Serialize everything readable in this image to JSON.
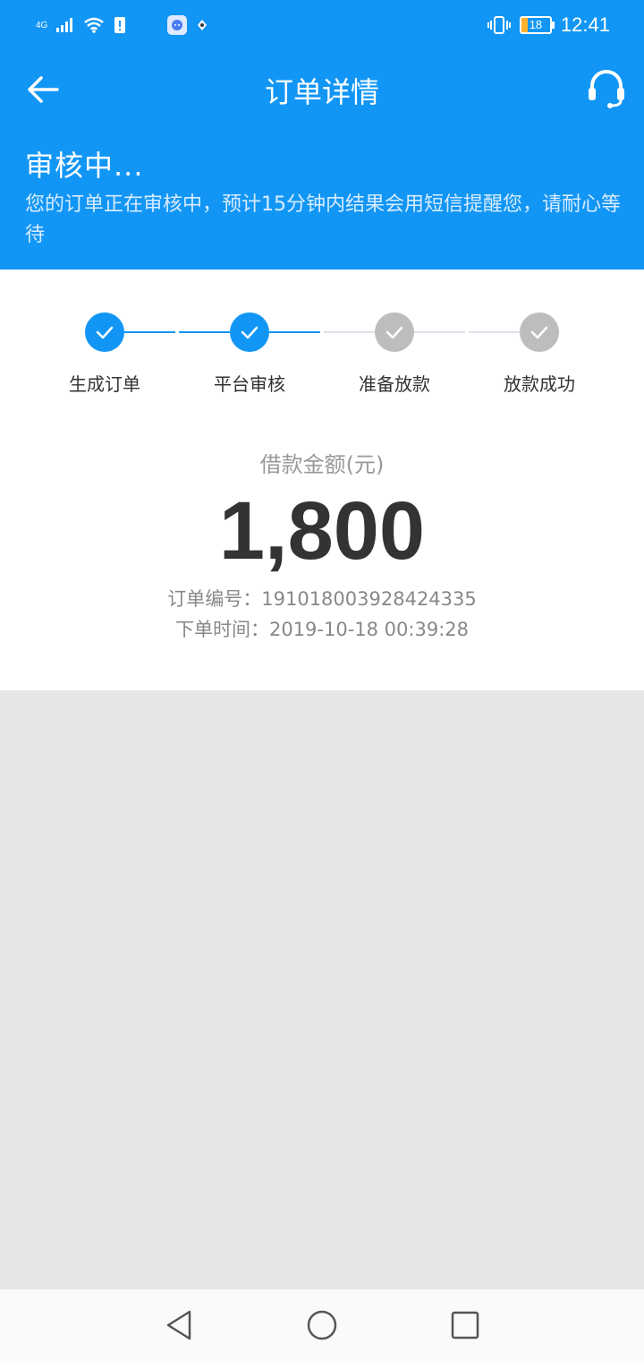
{
  "status_bar": {
    "network": "4G",
    "time": "12:41",
    "battery": "18"
  },
  "app_bar": {
    "title": "订单详情",
    "back_icon": "back-arrow-icon",
    "support_icon": "headset-icon"
  },
  "order_status": {
    "heading": "审核中...",
    "description": "您的订单正在审核中，预计15分钟内结果会用短信提醒您，请耐心等待"
  },
  "progress": {
    "steps": [
      {
        "label": "生成订单",
        "state": "done"
      },
      {
        "label": "平台审核",
        "state": "done"
      },
      {
        "label": "准备放款",
        "state": "pending"
      },
      {
        "label": "放款成功",
        "state": "pending"
      }
    ],
    "active_color": "#1296f5",
    "inactive_color": "#bdbdbd"
  },
  "loan": {
    "amount_label": "借款金额(元)",
    "amount": "1,800",
    "order_no": "订单编号：191018003928424335",
    "order_time": "下单时间：2019-10-18 00:39:28"
  },
  "nav": {
    "back_icon": "nav-back-icon",
    "home_icon": "nav-home-icon",
    "recents_icon": "nav-recents-icon"
  },
  "colors": {
    "primary": "#1296f5",
    "background": "#e6e6e6"
  }
}
